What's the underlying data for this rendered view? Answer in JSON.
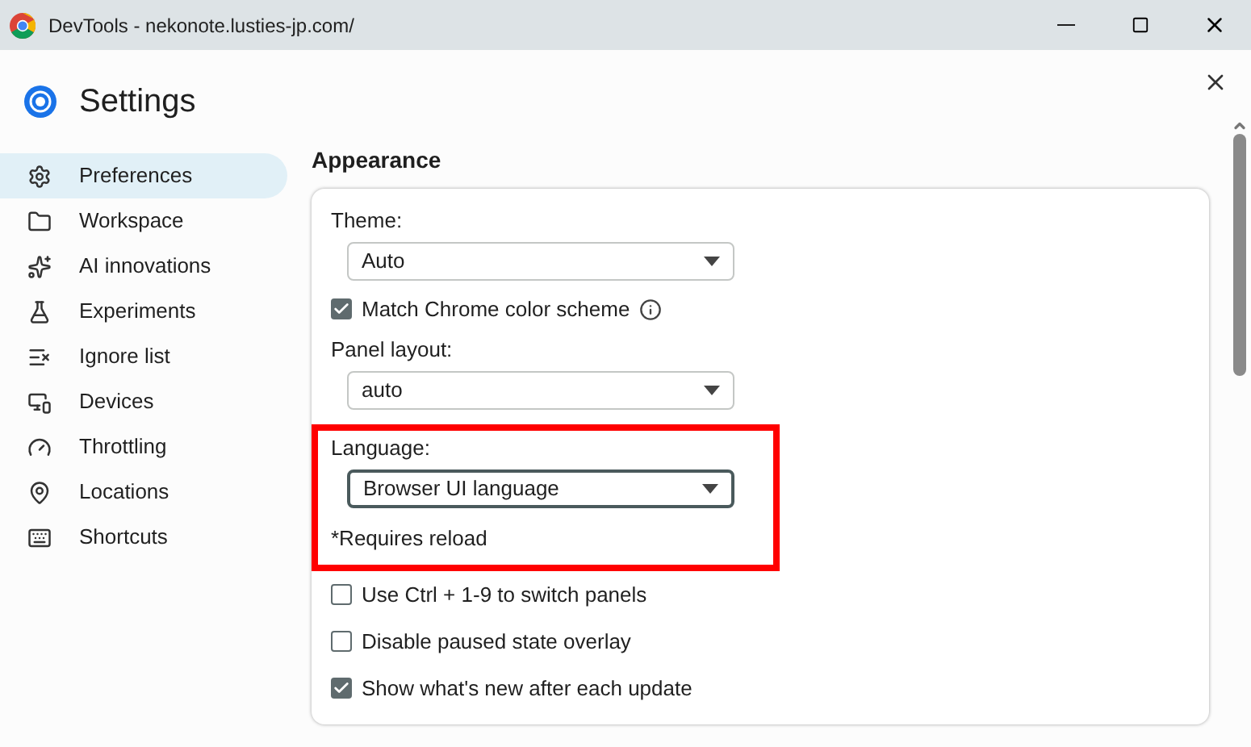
{
  "window": {
    "title": "DevTools - nekonote.lusties-jp.com/"
  },
  "header": {
    "title": "Settings"
  },
  "sidebar": {
    "items": [
      {
        "label": "Preferences",
        "selected": true
      },
      {
        "label": "Workspace",
        "selected": false
      },
      {
        "label": "AI innovations",
        "selected": false
      },
      {
        "label": "Experiments",
        "selected": false
      },
      {
        "label": "Ignore list",
        "selected": false
      },
      {
        "label": "Devices",
        "selected": false
      },
      {
        "label": "Throttling",
        "selected": false
      },
      {
        "label": "Locations",
        "selected": false
      },
      {
        "label": "Shortcuts",
        "selected": false
      }
    ]
  },
  "section": {
    "title": "Appearance",
    "items": [
      {
        "kind": "select",
        "label": "Theme:",
        "value": "Auto",
        "focused": false
      },
      {
        "kind": "checkbox",
        "label": "Match Chrome color scheme",
        "checked": true,
        "info": true
      },
      {
        "kind": "select",
        "label": "Panel layout:",
        "value": "auto",
        "focused": false
      },
      {
        "kind": "select",
        "label": "Language:",
        "value": "Browser UI language",
        "focused": true,
        "highlighted": true,
        "note": "*Requires reload"
      },
      {
        "kind": "checkbox",
        "label": "Use Ctrl + 1-9 to switch panels",
        "checked": false,
        "info": false
      },
      {
        "kind": "checkbox",
        "label": "Disable paused state overlay",
        "checked": false,
        "info": false
      },
      {
        "kind": "checkbox",
        "label": "Show what's new after each update",
        "checked": true,
        "info": false
      }
    ]
  }
}
